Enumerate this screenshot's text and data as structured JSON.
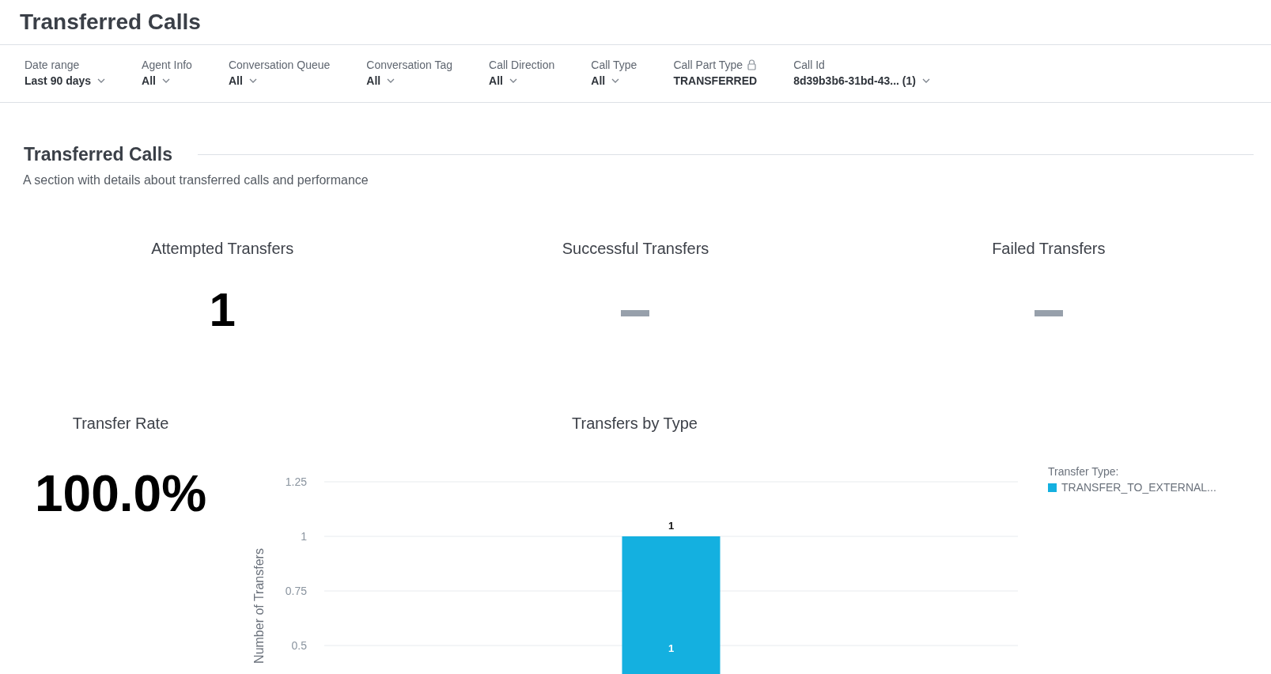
{
  "page_title": "Transferred Calls",
  "filters": [
    {
      "label": "Date range",
      "value": "Last 90 days",
      "locked": false
    },
    {
      "label": "Agent Info",
      "value": "All",
      "locked": false
    },
    {
      "label": "Conversation Queue",
      "value": "All",
      "locked": false
    },
    {
      "label": "Conversation Tag",
      "value": "All",
      "locked": false
    },
    {
      "label": "Call Direction",
      "value": "All",
      "locked": false
    },
    {
      "label": "Call Type",
      "value": "All",
      "locked": false
    },
    {
      "label": "Call Part Type",
      "value": "TRANSFERRED",
      "locked": true
    },
    {
      "label": "Call Id",
      "value": "8d39b3b6-31bd-43... (1)",
      "locked": false
    }
  ],
  "section": {
    "title": "Transferred Calls",
    "description": "A section with details about transferred calls and performance"
  },
  "kpis": [
    {
      "title": "Attempted Transfers",
      "kind": "number",
      "value": "1"
    },
    {
      "title": "Successful Transfers",
      "kind": "empty"
    },
    {
      "title": "Failed Transfers",
      "kind": "empty"
    }
  ],
  "transfer_rate": {
    "title": "Transfer Rate",
    "value": "100.0%"
  },
  "transfers_chart": {
    "title": "Transfers by Type",
    "legend_title": "Transfer Type:",
    "chart_data": {
      "type": "bar",
      "ylabel": "Number of Transfers",
      "ylim": [
        0.5,
        1.25
      ],
      "grid": true,
      "yticks": [
        0.5,
        0.75,
        {
          "value": 1,
          "label": "1"
        },
        1.25
      ],
      "data_labels": true,
      "annotations": [
        "1"
      ],
      "series": [
        {
          "name": "TRANSFER_TO_EXTERNAL...",
          "color": "#14b0e0",
          "values": [
            1
          ]
        }
      ]
    }
  }
}
